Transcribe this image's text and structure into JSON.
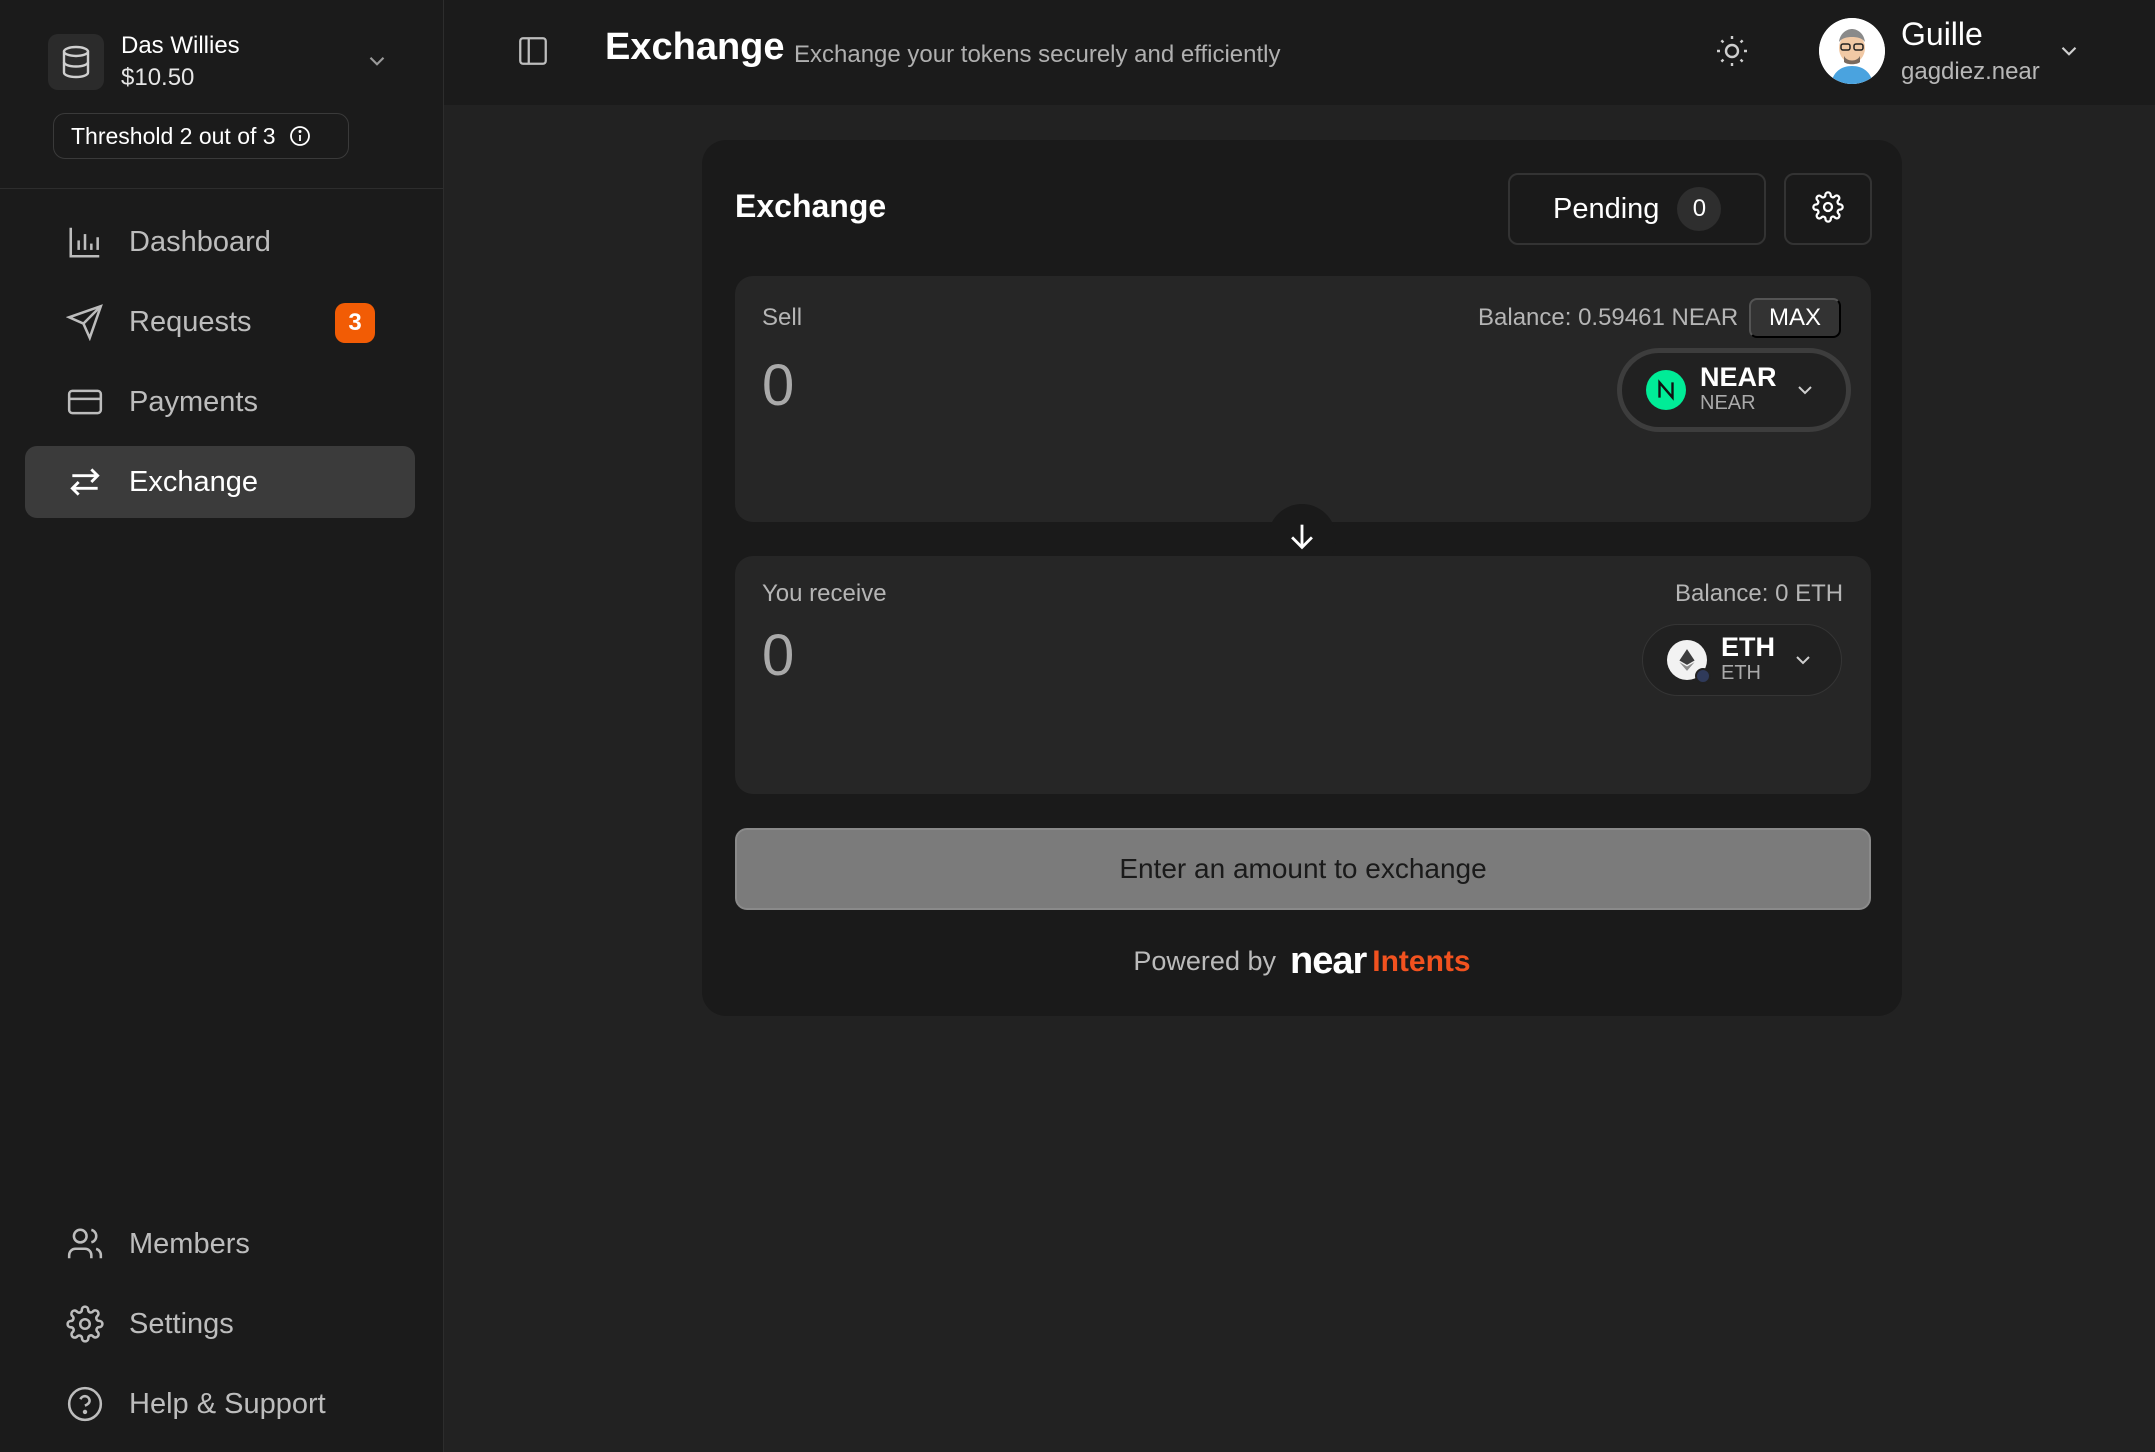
{
  "treasury": {
    "name": "Das Willies",
    "balance": "$10.50",
    "threshold": "Threshold 2 out of 3"
  },
  "sidebar": {
    "items": [
      {
        "label": "Dashboard",
        "icon": "bar-chart-icon"
      },
      {
        "label": "Requests",
        "icon": "send-icon",
        "badge": "3"
      },
      {
        "label": "Payments",
        "icon": "credit-card-icon"
      },
      {
        "label": "Exchange",
        "icon": "arrows-exchange-icon",
        "active": true
      }
    ],
    "footer_items": [
      {
        "label": "Members",
        "icon": "users-icon"
      },
      {
        "label": "Settings",
        "icon": "gear-icon"
      },
      {
        "label": "Help & Support",
        "icon": "help-circle-icon"
      }
    ]
  },
  "header": {
    "title": "Exchange",
    "subtitle": "Exchange your tokens securely and efficiently"
  },
  "user": {
    "name": "Guille",
    "account": "gagdiez.near"
  },
  "exchange": {
    "title": "Exchange",
    "pending_label": "Pending",
    "pending_count": "0",
    "sell": {
      "label": "Sell",
      "balance": "Balance: 0.59461 NEAR",
      "max_label": "MAX",
      "amount_placeholder": "0",
      "token_symbol": "NEAR",
      "token_network": "NEAR"
    },
    "receive": {
      "label": "You receive",
      "balance": "Balance: 0 ETH",
      "amount_placeholder": "0",
      "token_symbol": "ETH",
      "token_network": "ETH"
    },
    "submit_label": "Enter an amount to exchange",
    "powered_by": "Powered by",
    "brand_near": "near",
    "brand_intents": "Intents"
  },
  "colors": {
    "accent": "#f25c05",
    "near_green": "#00ec97",
    "intents_orange": "#f2521f"
  }
}
